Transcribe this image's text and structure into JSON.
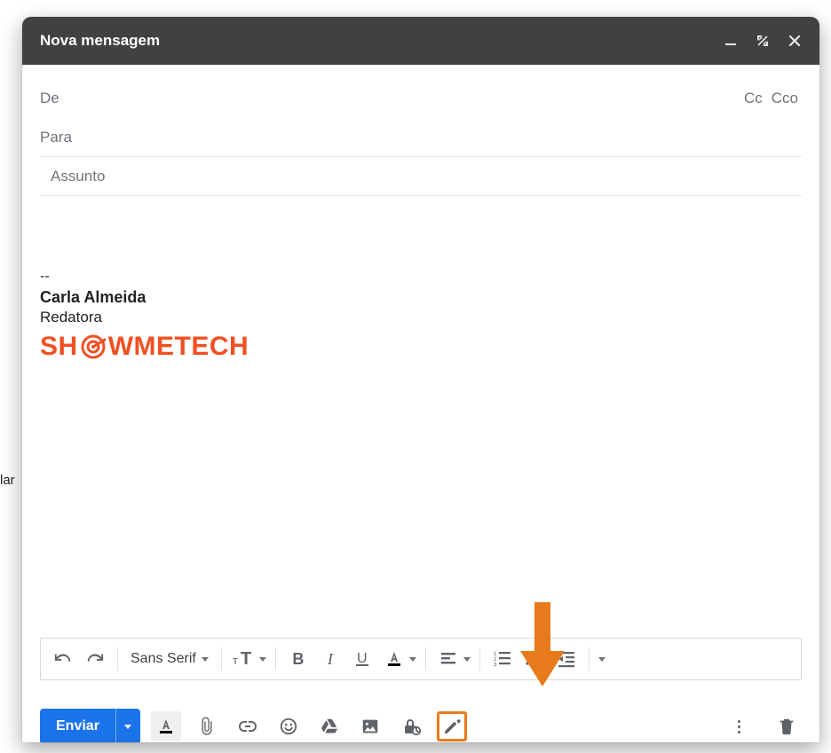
{
  "page": {
    "stray_text": "lar"
  },
  "header": {
    "title": "Nova mensagem",
    "icons": {
      "minimize": "minimize-icon",
      "expand": "expand-icon",
      "close": "close-icon"
    }
  },
  "fields": {
    "from_label": "De",
    "cc_label": "Cc",
    "cco_label": "Cco",
    "to_label": "Para",
    "subject_label": "Assunto",
    "to_value": "",
    "subject_value": ""
  },
  "body": {
    "content": ""
  },
  "signature": {
    "separator": "--",
    "name": "Carla Almeida",
    "role": "Redatora",
    "logo_prefix": "SH",
    "logo_suffix": "WMETECH"
  },
  "format_toolbar": {
    "font_name": "Sans Serif",
    "buttons": {
      "undo": "undo",
      "redo": "redo",
      "font_size": "font-size",
      "bold": "B",
      "italic": "I",
      "underline": "U",
      "text_color": "text-color",
      "align": "align",
      "list_numbered": "numbered-list",
      "list_bulleted": "bulleted-list",
      "indent_decrease": "indent-decrease",
      "more": "more"
    }
  },
  "bottom": {
    "send_label": "Enviar",
    "icons": {
      "format": "format-color-text",
      "attach": "attach",
      "link": "link",
      "emoji": "emoji",
      "drive": "drive",
      "photo": "photo",
      "confidential": "confidential",
      "signature": "signature-pen",
      "more": "more",
      "discard": "discard"
    }
  },
  "highlight": {
    "target": "signature-button"
  },
  "colors": {
    "accent": "#1a73e8",
    "brand": "#f05022",
    "highlight": "#e97a1b"
  }
}
